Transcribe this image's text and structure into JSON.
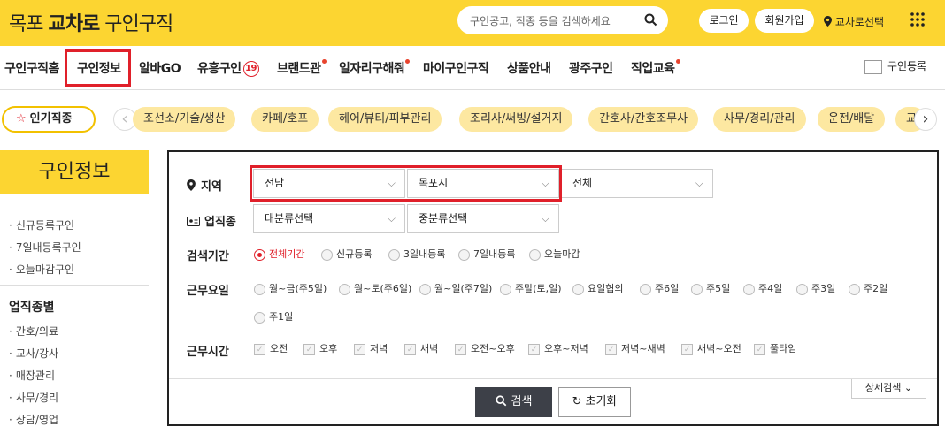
{
  "header": {
    "logo_prefix": "목포",
    "logo_bold": "교차로",
    "logo_suffix": "구인구직",
    "search_placeholder": "구인공고, 직종 등을 검색하세요",
    "login_label": "로그인",
    "signup_label": "회원가입",
    "location_label": "교차로선택"
  },
  "nav": {
    "items": [
      "구인구직홈",
      "구인정보",
      "알바GO",
      "유흥구인",
      "브랜드관",
      "일자리구해줘",
      "마이구인구직",
      "상품안내",
      "광주구인",
      "직업교육"
    ],
    "badge": "19",
    "register_label": "구인등록"
  },
  "popular": {
    "label": "인기직종",
    "chips": [
      "조선소/기술/생산",
      "카페/호프",
      "헤어/뷰티/피부관리",
      "조리사/써빙/설거지",
      "간호사/간호조무사",
      "사무/경리/관리",
      "운전/배달",
      "교"
    ]
  },
  "sidebar": {
    "title": "구인정보",
    "items": [
      "신규등록구인",
      "7일내등록구인",
      "오늘마감구인"
    ],
    "section_title": "업직종별",
    "section_items": [
      "간호/의료",
      "교사/강사",
      "매장관리",
      "사무/경리",
      "상담/영업"
    ]
  },
  "form": {
    "region_label": "지역",
    "region_province": "전남",
    "region_city": "목포시",
    "region_district": "전체",
    "job_label": "업직종",
    "job_major": "대분류선택",
    "job_minor": "중분류선택",
    "period_label": "검색기간",
    "periods": [
      "전체기간",
      "신규등록",
      "3일내등록",
      "7일내등록",
      "오늘마감"
    ],
    "workday_label": "근무요일",
    "workdays": [
      "월~금(주5일)",
      "월~토(주6일)",
      "월~일(주7일)",
      "주말(토,일)",
      "요일협의",
      "주6일",
      "주5일",
      "주4일",
      "주3일",
      "주2일",
      "주1일"
    ],
    "worktime_label": "근무시간",
    "worktimes": [
      "오전",
      "오후",
      "저녁",
      "새벽",
      "오전~오후",
      "오후~저녁",
      "저녁~새벽",
      "새벽~오전",
      "풀타임"
    ],
    "detail_label": "상세검색",
    "search_button": "검색",
    "reset_button": "초기화"
  },
  "colors": {
    "brand_yellow": "#fcd531",
    "highlight_red": "#e0202a",
    "chip_yellow": "#fde8a1",
    "search_button": "#3d4048"
  }
}
